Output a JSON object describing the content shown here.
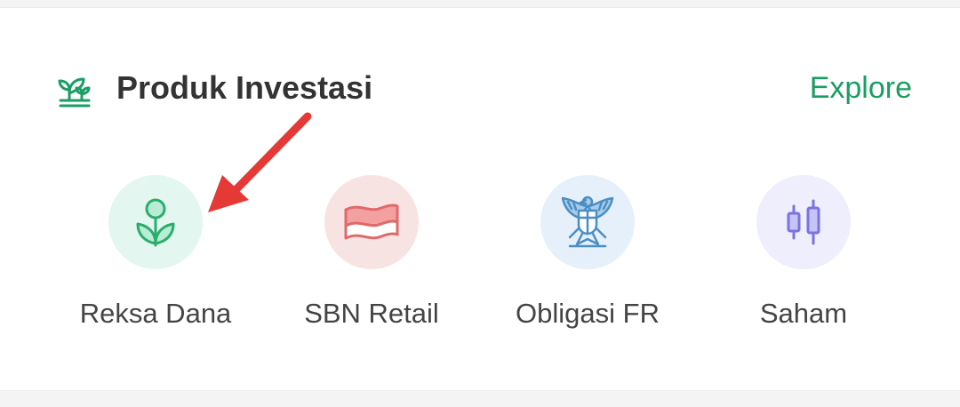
{
  "section": {
    "title": "Produk Investasi",
    "explore_label": "Explore",
    "icon": "plant-growth-icon"
  },
  "products": [
    {
      "label": "Reksa Dana",
      "icon": "tulip-icon",
      "bg": "#e3f6ef",
      "color": "#2aae6c"
    },
    {
      "label": "SBN Retail",
      "icon": "flag-icon",
      "bg": "#f8e3e3",
      "color": "#e06a6a"
    },
    {
      "label": "Obligasi FR",
      "icon": "garuda-icon",
      "bg": "#e6f0fa",
      "color": "#4a8fc4"
    },
    {
      "label": "Saham",
      "icon": "candlestick-icon",
      "bg": "#eeeefc",
      "color": "#7a73e0"
    }
  ],
  "colors": {
    "accent": "#1a9e62",
    "annotation_arrow": "#e53935"
  }
}
